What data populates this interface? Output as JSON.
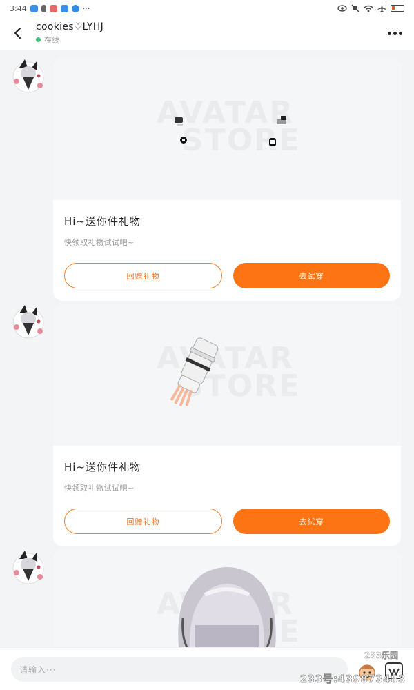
{
  "status_bar": {
    "time": "3:44",
    "dots": "···"
  },
  "header": {
    "title": "cookies♡LYHJ",
    "status": "在线"
  },
  "messages": [
    {
      "image_watermark_top": "AVATAR",
      "image_watermark_bottom": "STORE",
      "title": "Hi~送你件礼物",
      "description": "快领取礼物试试吧~",
      "secondary_button": "回赠礼物",
      "primary_button": "去试穿"
    },
    {
      "image_watermark_top": "AVATAR",
      "image_watermark_bottom": "STORE",
      "title": "Hi~送你件礼物",
      "description": "快领取礼物试试吧~",
      "secondary_button": "回赠礼物",
      "primary_button": "去试穿"
    },
    {
      "image_watermark_top": "AVATAR",
      "image_watermark_bottom": "STORE"
    }
  ],
  "input": {
    "placeholder": "请输入···"
  },
  "watermark": {
    "site": "233乐园",
    "id": "233号:439873483"
  },
  "colors": {
    "accent": "#fc7414",
    "online": "#3cc27a",
    "background": "#f3f4f6"
  },
  "icons": {
    "back": "chevron-left-icon",
    "more": "more-dots-icon",
    "emoji": "emoji-icon",
    "more_actions": "plus-icon"
  }
}
